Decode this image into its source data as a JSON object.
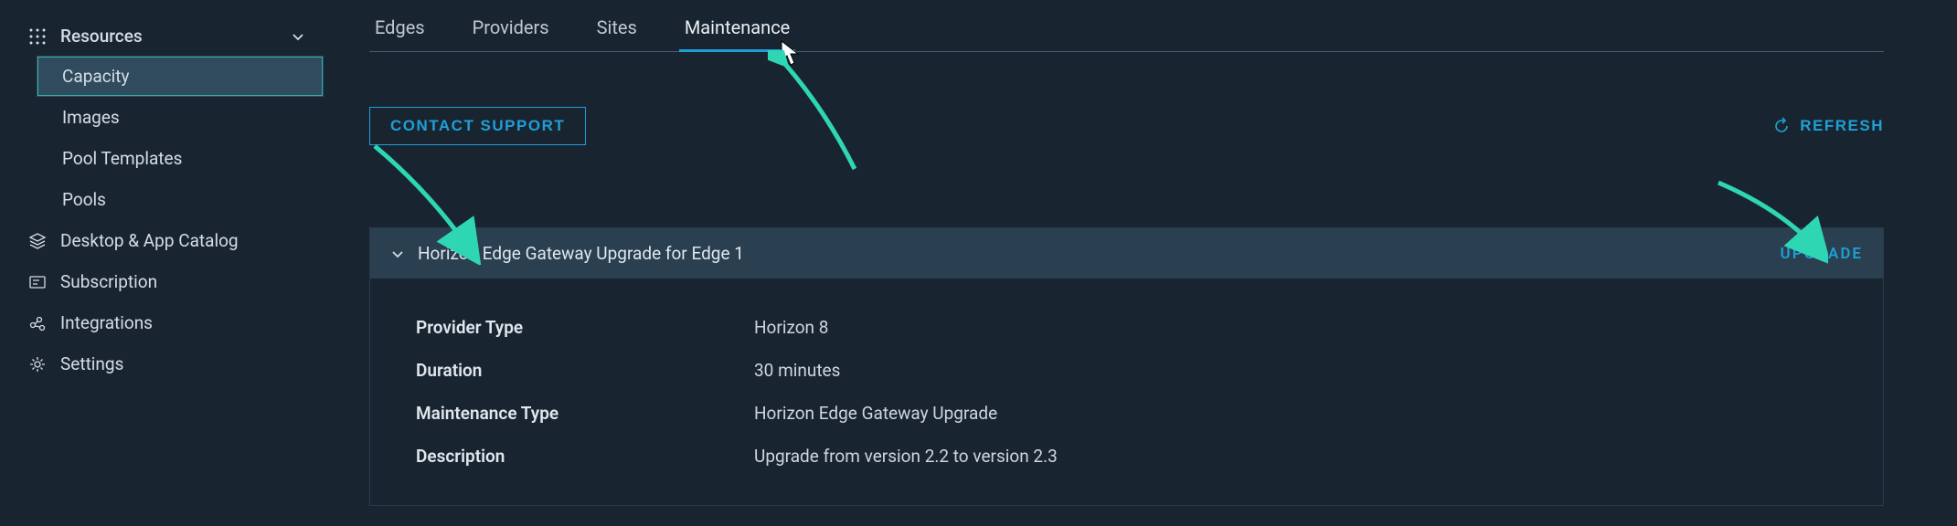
{
  "sidebar": {
    "resources": {
      "label": "Resources",
      "items": [
        "Capacity",
        "Images",
        "Pool Templates",
        "Pools"
      ],
      "activeIndex": 0
    },
    "nav": [
      {
        "label": "Desktop & App Catalog"
      },
      {
        "label": "Subscription"
      },
      {
        "label": "Integrations"
      },
      {
        "label": "Settings"
      }
    ]
  },
  "tabs": {
    "items": [
      "Edges",
      "Providers",
      "Sites",
      "Maintenance"
    ],
    "activeIndex": 3
  },
  "actions": {
    "contact_support": "CONTACT SUPPORT",
    "refresh": "REFRESH"
  },
  "panel": {
    "title": "Horizon Edge Gateway Upgrade for Edge 1",
    "action": "UPGRADE",
    "rows": [
      {
        "label": "Provider Type",
        "value": "Horizon 8"
      },
      {
        "label": "Duration",
        "value": "30 minutes"
      },
      {
        "label": "Maintenance Type",
        "value": "Horizon Edge Gateway Upgrade"
      },
      {
        "label": "Description",
        "value": "Upgrade from version 2.2 to version 2.3"
      }
    ]
  },
  "colors": {
    "accent_teal": "#2fd6b3",
    "accent_blue": "#1f9fd6",
    "panel_header": "#2a3f50"
  }
}
